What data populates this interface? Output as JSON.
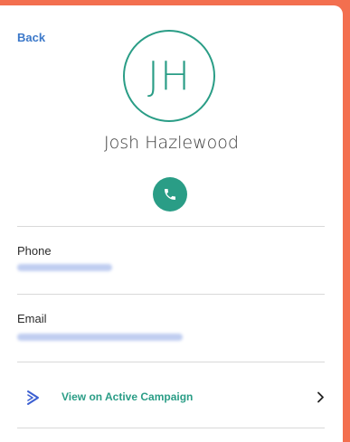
{
  "nav": {
    "back_label": "Back"
  },
  "contact": {
    "initials": "JH",
    "name": "Josh Hazlewood"
  },
  "fields": [
    {
      "label": "Phone"
    },
    {
      "label": "Email"
    }
  ],
  "campaign_link": {
    "label": "View on Active Campaign"
  },
  "colors": {
    "accent": "#2a9d86",
    "link": "#3b78c9",
    "background": "#f36f4f"
  },
  "icons": [
    "phone-icon",
    "active-campaign-icon",
    "chevron-right-icon"
  ]
}
